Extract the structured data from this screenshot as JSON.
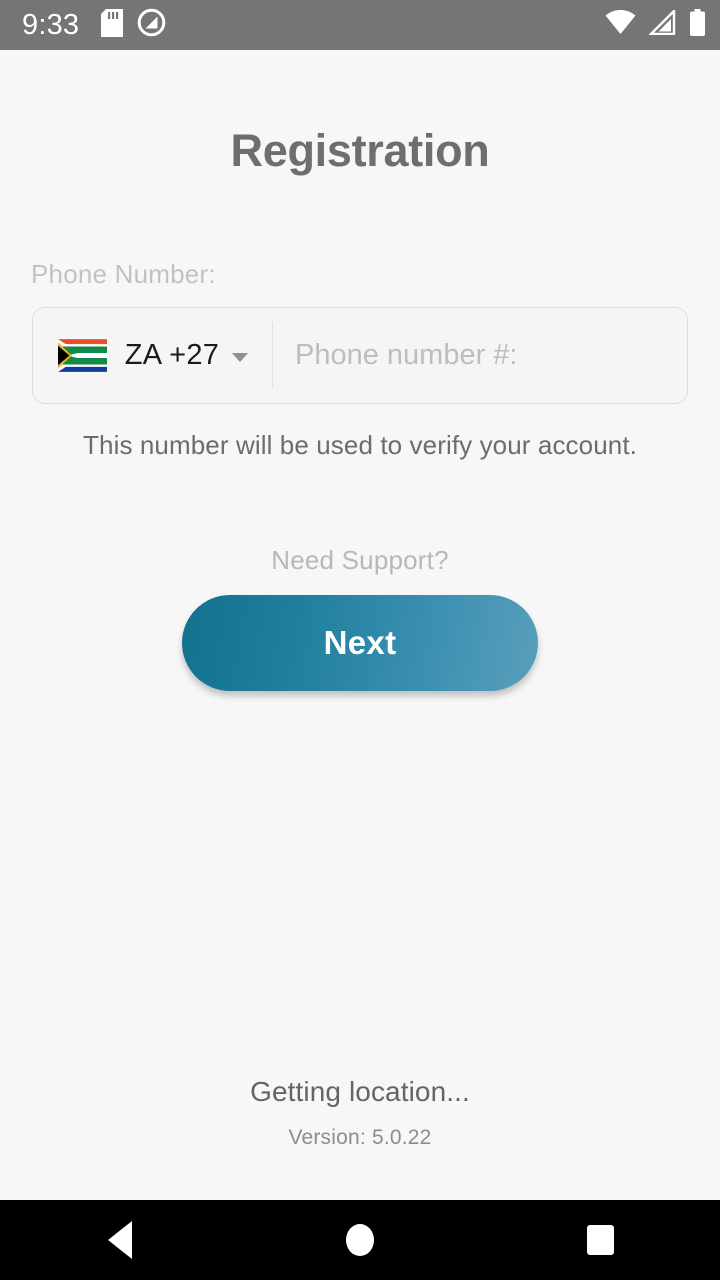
{
  "status_bar": {
    "time": "9:33",
    "left_icons": [
      "sd-card-icon",
      "no-sim-icon"
    ],
    "right_icons": [
      "wifi-icon",
      "cellular-signal-icon",
      "battery-icon"
    ],
    "background_color": "#757575"
  },
  "screen": {
    "title": "Registration",
    "background_color": "#f7f7f7"
  },
  "form": {
    "phone_label": "Phone Number:",
    "country": {
      "flag": "south-africa-flag",
      "code": "ZA  +27",
      "iso": "ZA",
      "dial_code": "+27"
    },
    "phone_input": {
      "value": "",
      "placeholder": "Phone number #:"
    },
    "verify_note": "This number will be used to verify your account."
  },
  "actions": {
    "support_link": "Need Support?",
    "next_label": "Next",
    "next_gradient_from": "#13718f",
    "next_gradient_to": "#5a9fbb"
  },
  "footer": {
    "location_status": "Getting location...",
    "version": "Version: 5.0.22"
  },
  "nav_bar": {
    "back": "back-icon",
    "home": "home-icon",
    "recents": "recents-icon",
    "background_color": "#000000"
  }
}
